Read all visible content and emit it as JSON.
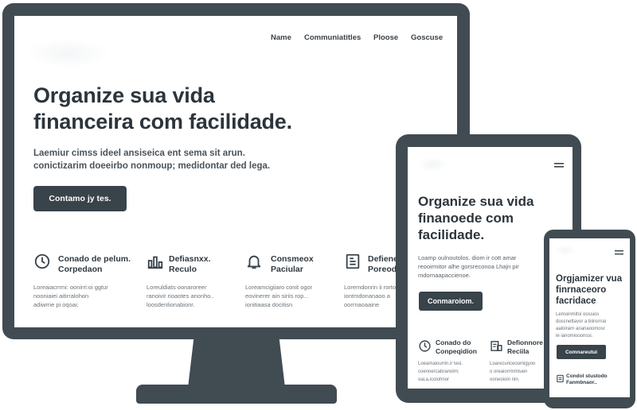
{
  "desktop": {
    "nav": [
      "Name",
      "Communiatitles",
      "Ploose",
      "Goscuse"
    ],
    "hero_title_line1": "Organize sua  vida",
    "hero_title_line2": "financeira com facilidade.",
    "hero_sub_line1": "Laemiur cimss ideel ansiseica ent sema sit arun.",
    "hero_sub_line2": "conictizarim doeeirbo nonmoup; medidontar ded lega.",
    "cta": "Contamo jy tes.",
    "features": [
      {
        "icon": "clock-icon",
        "title1": "Conado de pelum.",
        "title2": "Corpedaon",
        "text1": "Loreaiacrrmi: oonirri:oi ggtur",
        "text2": "nooniaiei aitirralohon",
        "text3": "adiwrrie pi oqoai;"
      },
      {
        "icon": "bar-chart-icon",
        "title1": "Defiasnxx.",
        "title2": "Reculo",
        "text1": "Loreuldiats oonaroreer",
        "text2": "ranoivir rioaotes anonho..",
        "text3": "loosdenlionabionr."
      },
      {
        "icon": "bell-icon",
        "title1": "Consmeox",
        "title2": "Paciular",
        "text1": "Loreamcigiiaro conit ogor",
        "text2": "eovinerer ain siriis rop...",
        "text3": "ionitiaasa docitisn"
      },
      {
        "icon": "document-icon",
        "title1": "Defiene",
        "title2": "Poreod",
        "text1": "Loremdonrin ii rorto",
        "text2": "iontmdonanaoo a",
        "text3": "oorrnaoaaine"
      }
    ]
  },
  "tablet": {
    "title_line1": "Organize sua vida",
    "title_line2": "finanoede com",
    "title_line3": "facilidade.",
    "sub_line1": "Loamp oulnoutolos. diom ir cott amar",
    "sub_line2": "reooirmitor alhe gorsreconoa Lhajn pir",
    "sub_line3": "mdornaapaccienoe.",
    "cta": "Conmaroiom.",
    "features": [
      {
        "icon": "clock-icon",
        "title1": "Conado do",
        "title2": "Conpeqidion",
        "text1": "Loeamaiourrin.ir tesi.",
        "text2": "coenoercabranolrn:",
        "text3": "oai,a,icoiohnor"
      },
      {
        "icon": "document-chart-icon",
        "title1": "Defionnore",
        "title2": "Reciila",
        "text1": "Loarecuriceoomigyoo",
        "text2": "o oreaiorrmmtuen",
        "text3": "ooneoioin nin."
      }
    ]
  },
  "phone": {
    "title_line1": "Orgjamizer vua",
    "title_line2": "finrnaceoro",
    "title_line3": "facridace",
    "sub_line1": "Lemoinmltoi oossios",
    "sub_line2": "doscnettavor a biirorrrai",
    "sub_line3": "aaloirarn aoanaoomosr",
    "sub_line4": "ie ianomiooonssi.",
    "cta": "Comnareutui",
    "feature_title1": "Condol stustodo",
    "feature_title2": "Fanmbnaor.."
  }
}
